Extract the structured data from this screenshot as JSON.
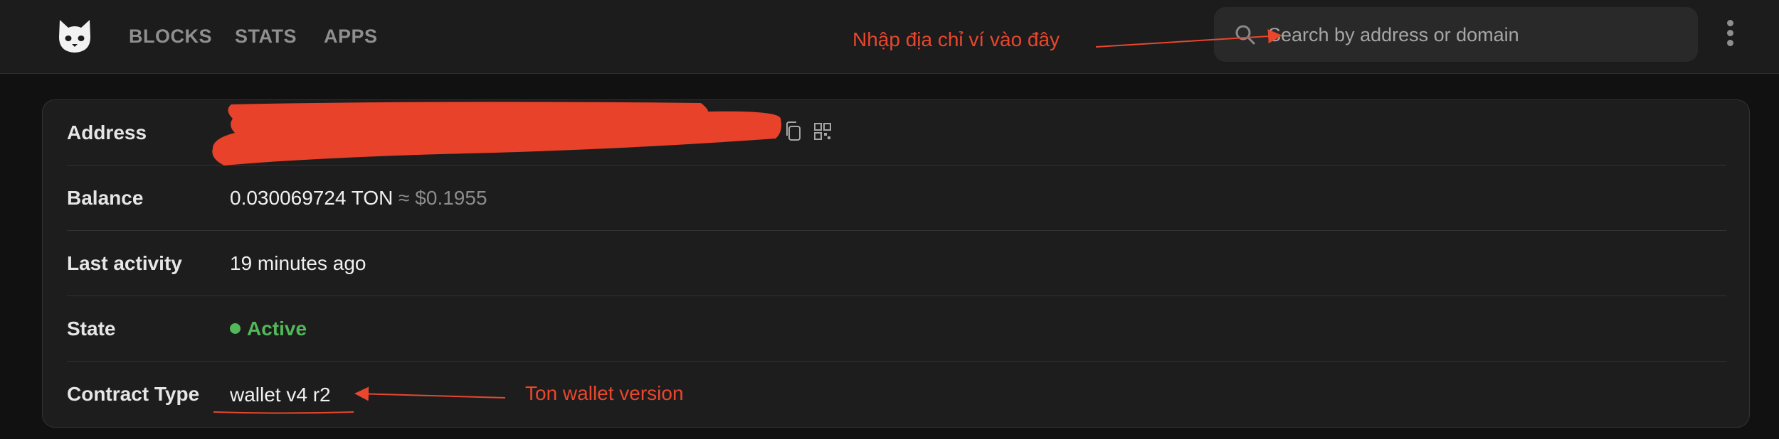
{
  "nav": {
    "items": [
      "BLOCKS",
      "STATS",
      "APPS"
    ]
  },
  "search": {
    "placeholder": "Search by address or domain",
    "icon": "search-icon"
  },
  "annotations": {
    "search_hint": "Nhập địa chỉ ví vào đây",
    "version_hint": "Ton wallet version"
  },
  "account": {
    "rows": [
      {
        "label": "Address"
      },
      {
        "label": "Balance",
        "amount": "0.030069724 TON",
        "approx": "≈ $0.1955"
      },
      {
        "label": "Last activity",
        "value": "19 minutes ago"
      },
      {
        "label": "State",
        "value": "Active"
      },
      {
        "label": "Contract Type",
        "value": "wallet v4 r2"
      }
    ]
  },
  "colors": {
    "background": "#111111",
    "header": "#1c1c1c",
    "card": "#1d1d1d",
    "annotation": "#e8472e",
    "active": "#52b85a"
  }
}
